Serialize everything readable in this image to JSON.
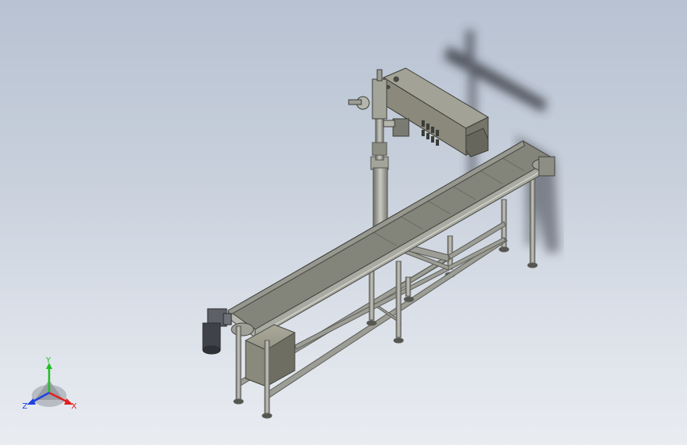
{
  "view": {
    "background_top": "#b8c2d2",
    "background_bottom": "#e9ecf1"
  },
  "model": {
    "frame_color": "#8e8f88",
    "belt_color": "#7d7e74",
    "printer_color": "#8f8e80",
    "motor_color": "#4a4d52"
  },
  "triad": {
    "x_label": "X",
    "y_label": "Y",
    "z_label": "Z",
    "x_color": "#e02020",
    "y_color": "#20c020",
    "z_color": "#2040e0"
  }
}
